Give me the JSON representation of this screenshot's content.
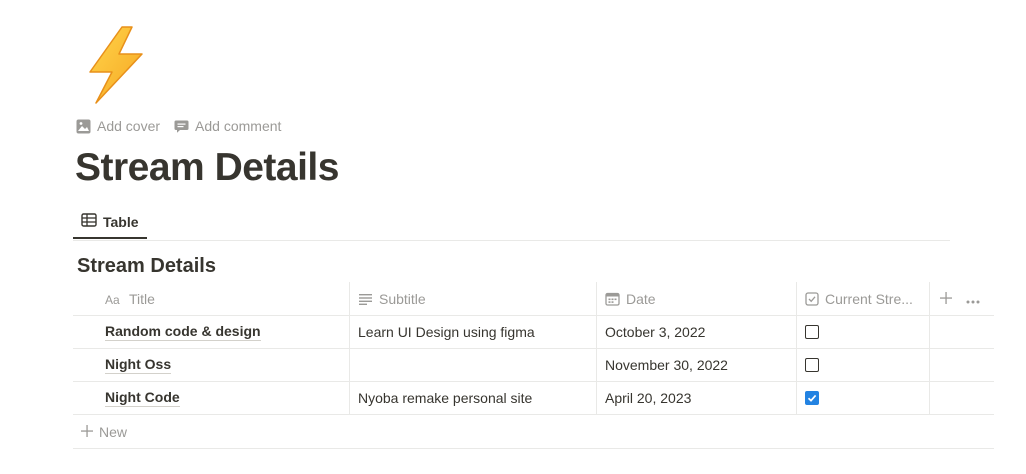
{
  "page": {
    "icon": "lightning-bolt-emoji",
    "actions": {
      "add_cover": "Add cover",
      "add_comment": "Add comment"
    },
    "title": "Stream Details"
  },
  "views": {
    "tabs": [
      {
        "label": "Table",
        "icon": "table-icon",
        "active": true
      }
    ]
  },
  "database": {
    "title": "Stream Details",
    "columns": [
      {
        "label": "Title",
        "icon": "text-aa-icon"
      },
      {
        "label": "Subtitle",
        "icon": "text-lines-icon"
      },
      {
        "label": "Date",
        "icon": "calendar-icon"
      },
      {
        "label": "Current Stre...",
        "icon": "checkbox-icon"
      }
    ],
    "rows": [
      {
        "title": "Random code & design",
        "subtitle": "Learn UI Design using figma",
        "date": "October 3, 2022",
        "current": false
      },
      {
        "title": "Night Oss",
        "subtitle": "",
        "date": "November 30, 2022",
        "current": false
      },
      {
        "title": "Night Code",
        "subtitle": "Nyoba remake personal site",
        "date": "April 20, 2023",
        "current": true
      }
    ],
    "new_label": "New"
  },
  "colors": {
    "text": "#37352f",
    "muted": "#9b9a97",
    "border": "#e9e9e7",
    "accent_blue": "#2383e2",
    "bolt_yellow": "#ffc83d"
  }
}
